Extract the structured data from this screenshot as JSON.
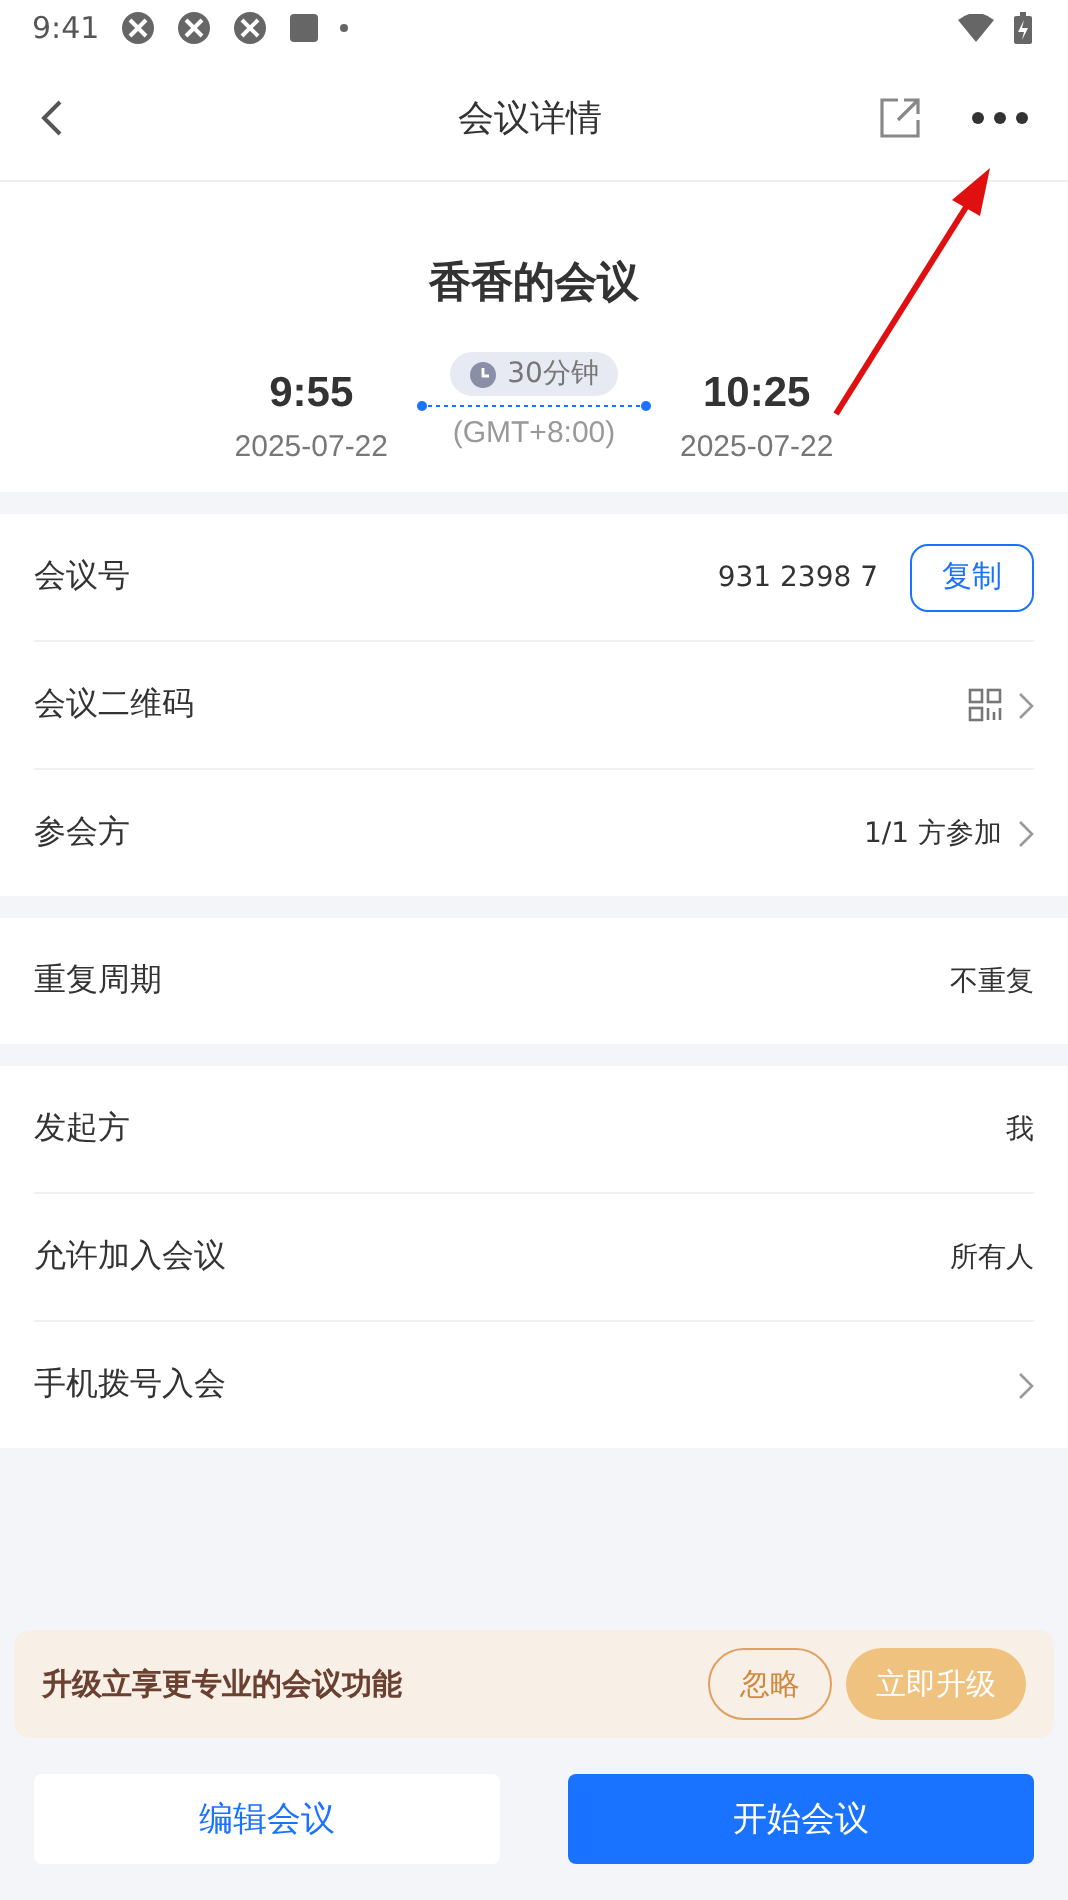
{
  "status_bar": {
    "time": "9:41"
  },
  "header": {
    "title": "会议详情"
  },
  "meeting": {
    "title": "香香的会议",
    "start_time": "9:55",
    "start_date": "2025-07-22",
    "duration": "30分钟",
    "timezone": "(GMT+8:00)",
    "end_time": "10:25",
    "end_date": "2025-07-22"
  },
  "sections": [
    {
      "rows": [
        {
          "kind": "copy",
          "label": "会议号",
          "value": "931 2398 7",
          "action": "复制"
        },
        {
          "kind": "qr",
          "label": "会议二维码"
        },
        {
          "kind": "link",
          "label": "参会方",
          "value": "1/1 方参加"
        }
      ]
    },
    {
      "rows": [
        {
          "kind": "text",
          "label": "重复周期",
          "value": "不重复"
        }
      ]
    },
    {
      "rows": [
        {
          "kind": "text",
          "label": "发起方",
          "value": "我"
        },
        {
          "kind": "text",
          "label": "允许加入会议",
          "value": "所有人"
        },
        {
          "kind": "link",
          "label": "手机拨号入会"
        }
      ]
    }
  ],
  "upgrade_banner": {
    "text": "升级立享更专业的会议功能",
    "ignore": "忽略",
    "upgrade": "立即升级"
  },
  "buttons": [
    {
      "kind": "secondary",
      "label": "编辑会议"
    },
    {
      "kind": "primary",
      "label": "开始会议"
    }
  ]
}
